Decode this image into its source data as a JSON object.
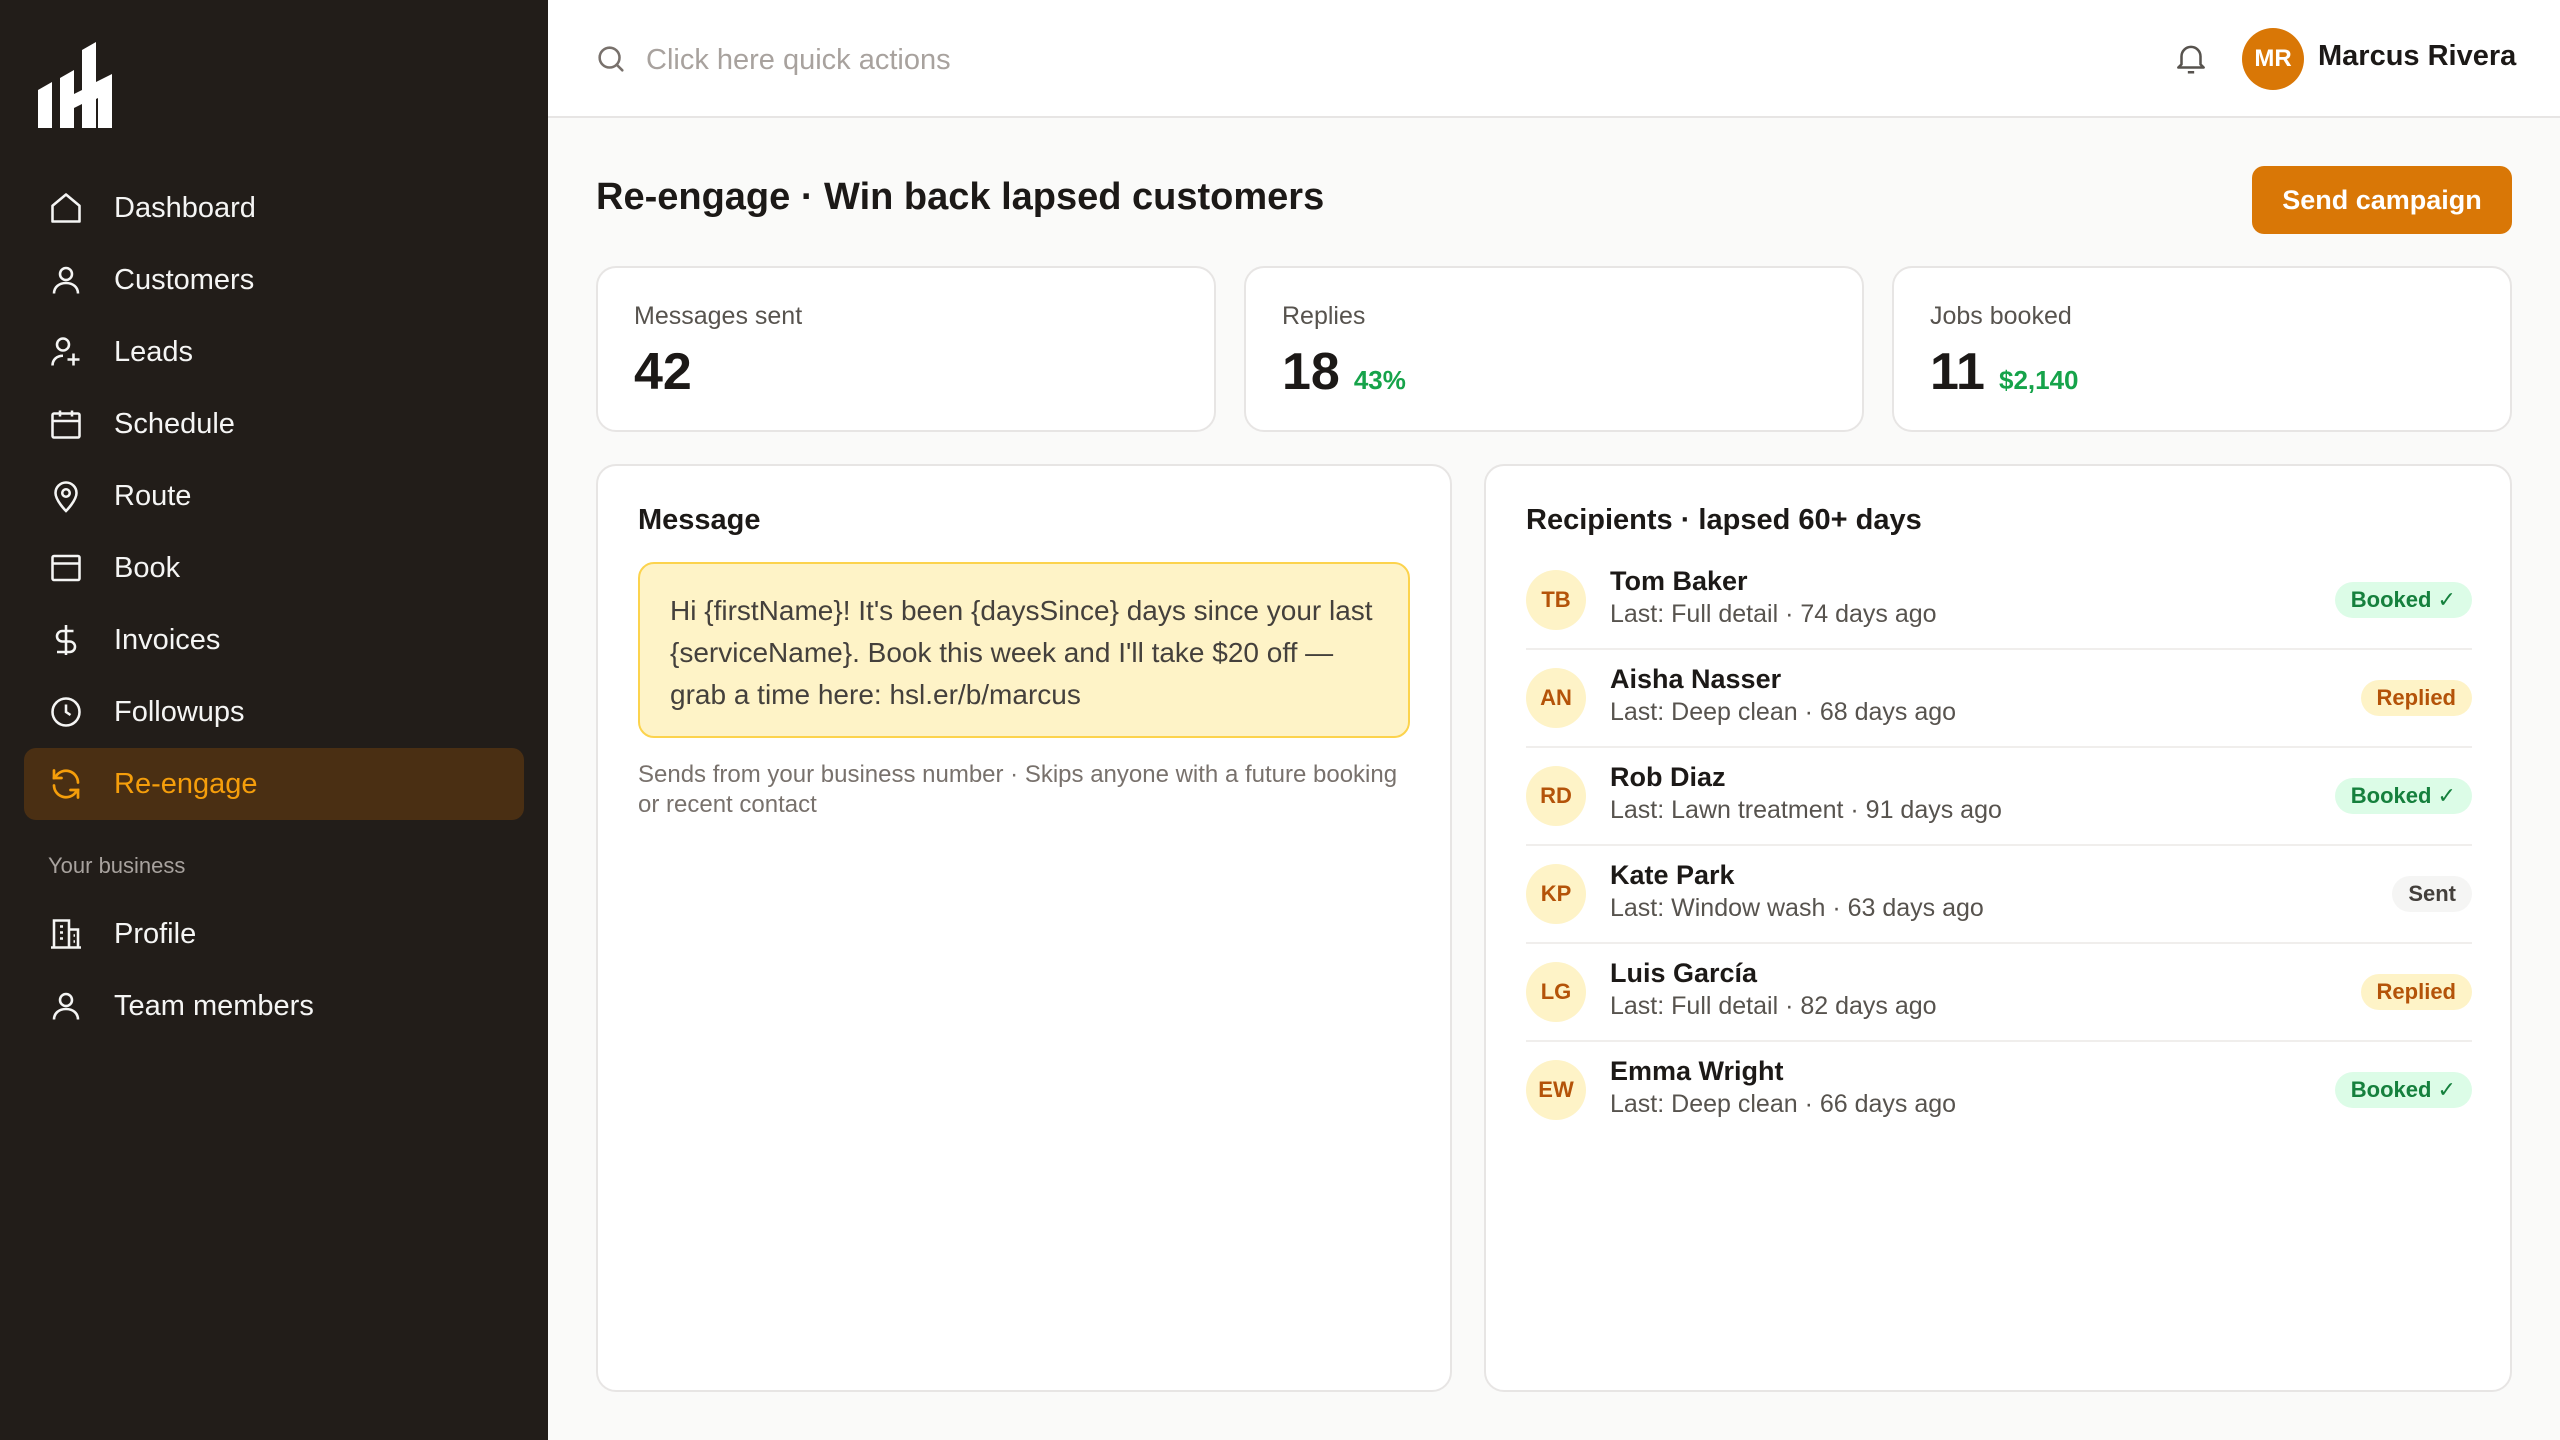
{
  "sidebar": {
    "items": [
      {
        "label": "Dashboard",
        "icon": "home-icon"
      },
      {
        "label": "Customers",
        "icon": "user-icon"
      },
      {
        "label": "Leads",
        "icon": "user-plus-icon"
      },
      {
        "label": "Schedule",
        "icon": "calendar-icon"
      },
      {
        "label": "Route",
        "icon": "map-pin-icon"
      },
      {
        "label": "Book",
        "icon": "browser-icon"
      },
      {
        "label": "Invoices",
        "icon": "dollar-icon"
      },
      {
        "label": "Followups",
        "icon": "clock-icon"
      },
      {
        "label": "Re-engage",
        "icon": "refresh-icon",
        "active": true
      }
    ],
    "section_label": "Your business",
    "business_items": [
      {
        "label": "Profile",
        "icon": "building-icon"
      },
      {
        "label": "Team members",
        "icon": "user-icon"
      }
    ]
  },
  "topbar": {
    "search_placeholder": "Click here quick actions",
    "user_initials": "MR",
    "user_name": "Marcus Rivera"
  },
  "page": {
    "title": "Re-engage · Win back lapsed customers",
    "send_button": "Send campaign"
  },
  "stats": [
    {
      "label": "Messages sent",
      "value": "42",
      "sub": ""
    },
    {
      "label": "Replies",
      "value": "18",
      "sub": "43%"
    },
    {
      "label": "Jobs booked",
      "value": "11",
      "sub": "$2,140"
    }
  ],
  "message": {
    "title": "Message",
    "body": "Hi {firstName}! It's been {daysSince} days since your last {serviceName}. Book this week and I'll take $20 off — grab a time here: hsl.er/b/marcus",
    "note": "Sends from your business number · Skips anyone with a future booking or recent contact"
  },
  "recipients": {
    "title": "Recipients · lapsed 60+ days",
    "rows": [
      {
        "initials": "TB",
        "name": "Tom Baker",
        "detail": "Last: Full detail · 74 days ago",
        "status": "Booked ✓",
        "status_type": "booked"
      },
      {
        "initials": "AN",
        "name": "Aisha Nasser",
        "detail": "Last: Deep clean · 68 days ago",
        "status": "Replied",
        "status_type": "replied"
      },
      {
        "initials": "RD",
        "name": "Rob Diaz",
        "detail": "Last: Lawn treatment · 91 days ago",
        "status": "Booked ✓",
        "status_type": "booked"
      },
      {
        "initials": "KP",
        "name": "Kate Park",
        "detail": "Last: Window wash · 63 days ago",
        "status": "Sent",
        "status_type": "sent"
      },
      {
        "initials": "LG",
        "name": "Luis García",
        "detail": "Last: Full detail · 82 days ago",
        "status": "Replied",
        "status_type": "replied"
      },
      {
        "initials": "EW",
        "name": "Emma Wright",
        "detail": "Last: Deep clean · 66 days ago",
        "status": "Booked ✓",
        "status_type": "booked"
      }
    ]
  },
  "colors": {
    "sidebar_bg": "#221d19",
    "accent": "#d97706",
    "active_bg": "#4a2f13",
    "success": "#16a34a",
    "message_bg": "#fef3c7"
  }
}
